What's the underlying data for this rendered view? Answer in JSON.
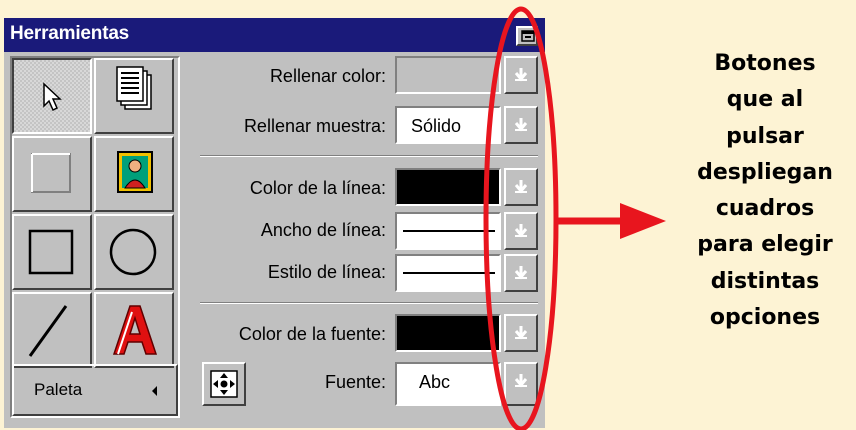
{
  "window": {
    "title": "Herramientas"
  },
  "icons": {
    "select": "arrow-pointer-icon",
    "text_block": "text-document-icon",
    "rectangle_filled": "filled-rectangle-icon",
    "image": "picture-frame-icon",
    "rectangle": "rectangle-icon",
    "ellipse": "ellipse-icon",
    "line": "line-icon",
    "wordart": "letter-a-icon",
    "move": "move-arrows-icon",
    "dropdown": "dropdown-arrow-icon"
  },
  "tools": {
    "paleta_label": "Paleta"
  },
  "properties": [
    {
      "label": "Rellenar color:",
      "value": ""
    },
    {
      "label": "Rellenar muestra:",
      "value": "Sólido"
    },
    {
      "label": "Color de la línea:",
      "value": ""
    },
    {
      "label": "Ancho de línea:",
      "value": ""
    },
    {
      "label": "Estilo de línea:",
      "value": ""
    },
    {
      "label": "Color de la fuente:",
      "value": ""
    },
    {
      "label": "Fuente:",
      "value": "Abc"
    }
  ],
  "annotation": {
    "lines": [
      "Botones",
      "que al",
      "pulsar",
      "despliegan",
      "cuadros",
      "para elegir",
      "distintas",
      "opciones"
    ]
  },
  "colors": {
    "titlebar": "#1a1a7a",
    "panel": "#c0c0c0",
    "background": "#fdf3d4",
    "highlight": "#e8151e",
    "line_color": "#000000",
    "font_color": "#000000"
  }
}
